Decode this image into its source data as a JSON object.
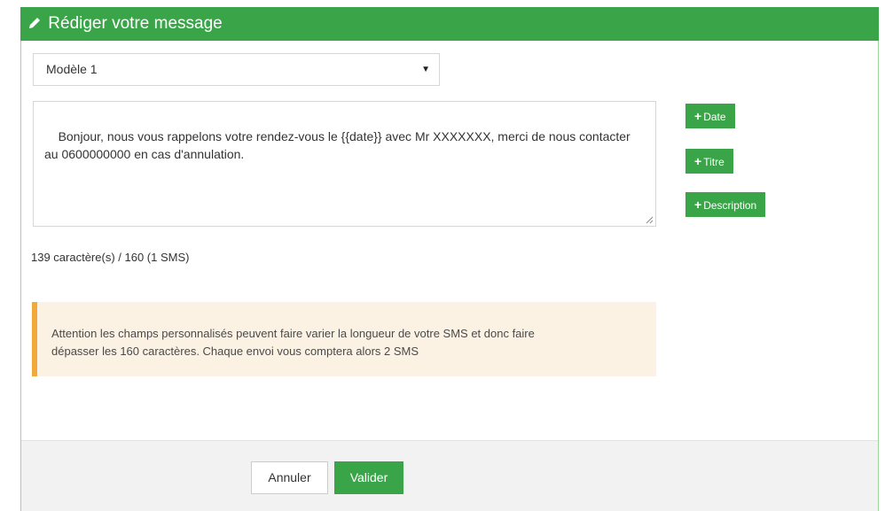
{
  "header": {
    "title": "Rédiger votre message",
    "icon": "pencil-icon"
  },
  "template_select": {
    "selected": "Modèle 1"
  },
  "message": {
    "text": "Bonjour, nous vous rappelons votre rendez-vous le {{date}} avec Mr XXXXXXX, merci de nous contacter au 0600000000 en cas d'annulation."
  },
  "insert_buttons": {
    "date": "Date",
    "titre": "Titre",
    "description": "Description"
  },
  "counter": "139 caractère(s) / 160 (1 SMS)",
  "alert": {
    "line1": "Attention les champs personnalisés peuvent faire varier la longueur de votre SMS et donc faire",
    "line2": "dépasser les 160 caractères. Chaque envoi vous comptera alors 2 SMS"
  },
  "footer": {
    "cancel_label": "Annuler",
    "submit_label": "Valider"
  },
  "colors": {
    "primary_green": "#3aa548",
    "alert_bg": "#fcf2e4",
    "alert_border": "#f0a93a"
  }
}
